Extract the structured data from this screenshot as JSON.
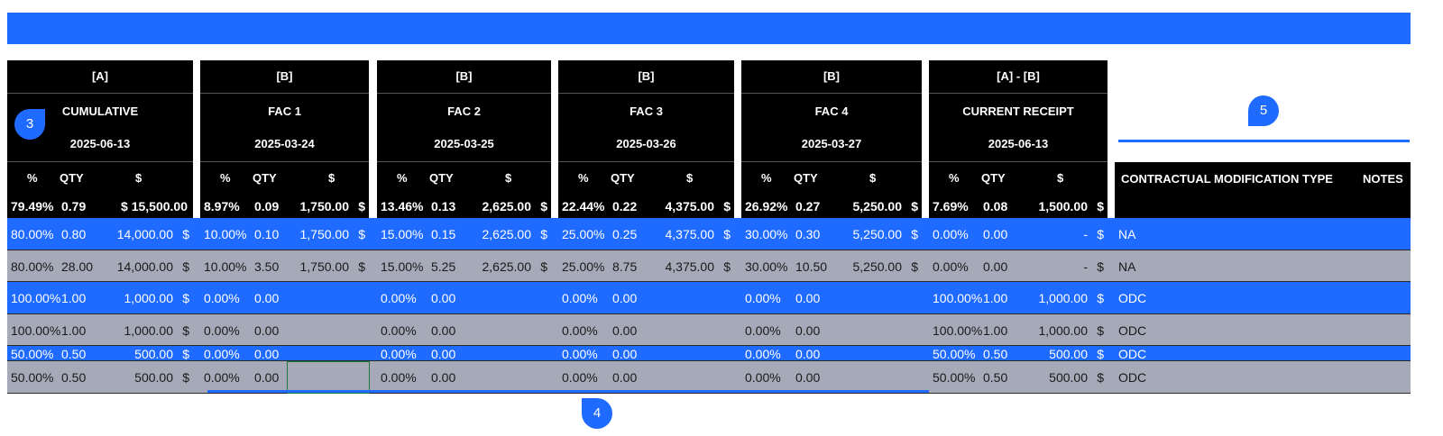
{
  "colors": {
    "accent": "#1f6bff",
    "header_bg": "#000000",
    "grey_row": "#a5a9b8"
  },
  "groups": [
    {
      "tag": "[A]",
      "name": "CUMULATIVE",
      "date": "2025-06-13",
      "total": {
        "pct": "79.49%",
        "qty": "0.79",
        "amt": "$ 15,500.00",
        "cur": ""
      }
    },
    {
      "tag": "[B]",
      "name": "FAC 1",
      "date": "2025-03-24",
      "total": {
        "pct": "8.97%",
        "qty": "0.09",
        "amt": "1,750.00",
        "cur": "$"
      }
    },
    {
      "tag": "[B]",
      "name": "FAC 2",
      "date": "2025-03-25",
      "total": {
        "pct": "13.46%",
        "qty": "0.13",
        "amt": "2,625.00",
        "cur": "$"
      }
    },
    {
      "tag": "[B]",
      "name": "FAC 3",
      "date": "2025-03-26",
      "total": {
        "pct": "22.44%",
        "qty": "0.22",
        "amt": "4,375.00",
        "cur": "$"
      }
    },
    {
      "tag": "[B]",
      "name": "FAC 4",
      "date": "2025-03-27",
      "total": {
        "pct": "26.92%",
        "qty": "0.27",
        "amt": "5,250.00",
        "cur": "$"
      }
    },
    {
      "tag": "[A] - [B]",
      "name": "CURRENT RECEIPT",
      "date": "2025-06-13",
      "total": {
        "pct": "7.69%",
        "qty": "0.08",
        "amt": "1,500.00",
        "cur": "$"
      }
    }
  ],
  "subheaders": {
    "pct": "%",
    "qty": "QTY",
    "amt": "$"
  },
  "extra_headers": {
    "mod_type": "CONTRACTUAL MODIFICATION TYPE",
    "notes": "NOTES"
  },
  "rows": [
    {
      "cells": [
        [
          "80.00%",
          "0.80",
          "14,000.00",
          "$"
        ],
        [
          "10.00%",
          "0.10",
          "1,750.00",
          "$"
        ],
        [
          "15.00%",
          "0.15",
          "2,625.00",
          "$"
        ],
        [
          "25.00%",
          "0.25",
          "4,375.00",
          "$"
        ],
        [
          "30.00%",
          "0.30",
          "5,250.00",
          "$"
        ],
        [
          "0.00%",
          "0.00",
          "-",
          "$"
        ]
      ],
      "mod": "NA"
    },
    {
      "cells": [
        [
          "80.00%",
          "28.00",
          "14,000.00",
          "$"
        ],
        [
          "10.00%",
          "3.50",
          "1,750.00",
          "$"
        ],
        [
          "15.00%",
          "5.25",
          "2,625.00",
          "$"
        ],
        [
          "25.00%",
          "8.75",
          "4,375.00",
          "$"
        ],
        [
          "30.00%",
          "10.50",
          "5,250.00",
          "$"
        ],
        [
          "0.00%",
          "0.00",
          "-",
          "$"
        ]
      ],
      "mod": "NA"
    },
    {
      "cells": [
        [
          "100.00%",
          "1.00",
          "1,000.00",
          "$"
        ],
        [
          "0.00%",
          "0.00",
          "",
          ""
        ],
        [
          "0.00%",
          "0.00",
          "",
          ""
        ],
        [
          "0.00%",
          "0.00",
          "",
          ""
        ],
        [
          "0.00%",
          "0.00",
          "",
          ""
        ],
        [
          "100.00%",
          "1.00",
          "1,000.00",
          "$"
        ]
      ],
      "mod": "ODC"
    },
    {
      "cells": [
        [
          "100.00%",
          "1.00",
          "1,000.00",
          "$"
        ],
        [
          "0.00%",
          "0.00",
          "",
          ""
        ],
        [
          "0.00%",
          "0.00",
          "",
          ""
        ],
        [
          "0.00%",
          "0.00",
          "",
          ""
        ],
        [
          "0.00%",
          "0.00",
          "",
          ""
        ],
        [
          "100.00%",
          "1.00",
          "1,000.00",
          "$"
        ]
      ],
      "mod": "ODC"
    },
    {
      "cells": [
        [
          "50.00%",
          "0.50",
          "500.00",
          "$"
        ],
        [
          "0.00%",
          "0.00",
          "",
          ""
        ],
        [
          "0.00%",
          "0.00",
          "",
          ""
        ],
        [
          "0.00%",
          "0.00",
          "",
          ""
        ],
        [
          "0.00%",
          "0.00",
          "",
          ""
        ],
        [
          "50.00%",
          "0.50",
          "500.00",
          "$"
        ]
      ],
      "mod": "ODC"
    },
    {
      "cells": [
        [
          "50.00%",
          "0.50",
          "500.00",
          "$"
        ],
        [
          "0.00%",
          "0.00",
          "",
          ""
        ],
        [
          "0.00%",
          "0.00",
          "",
          ""
        ],
        [
          "0.00%",
          "0.00",
          "",
          ""
        ],
        [
          "0.00%",
          "0.00",
          "",
          ""
        ],
        [
          "50.00%",
          "0.50",
          "500.00",
          "$"
        ]
      ],
      "mod": "ODC"
    }
  ],
  "markers": {
    "m3": "3",
    "m4": "4",
    "m5": "5"
  }
}
